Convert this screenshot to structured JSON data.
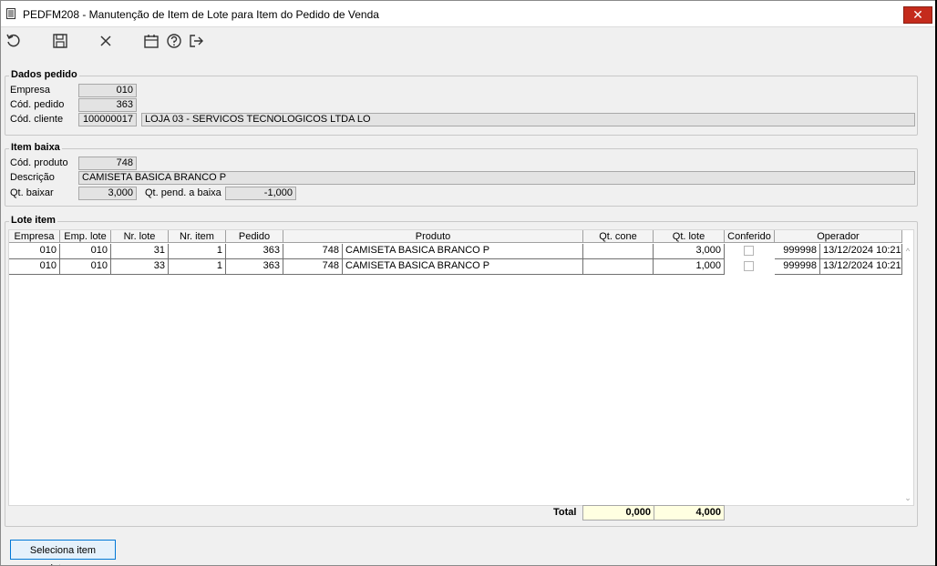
{
  "window": {
    "title": "PEDFM208 - Manutenção de Item de Lote para Item do Pedido de Venda",
    "close_symbol": "✕"
  },
  "toolbar": {
    "icons": [
      "undo-icon",
      "save-icon",
      "cancel-icon",
      "calendar-icon",
      "help-icon",
      "exit-icon"
    ]
  },
  "dados_pedido": {
    "title": "Dados pedido",
    "empresa_label": "Empresa",
    "empresa_value": "010",
    "pedido_label": "Cód. pedido",
    "pedido_value": "363",
    "cliente_label": "Cód. cliente",
    "cliente_code": "100000017",
    "cliente_name": "LOJA 03 - SERVICOS TECNOLOGICOS LTDA   LO"
  },
  "item_baixa": {
    "title": "Item baixa",
    "produto_label": "Cód. produto",
    "produto_value": "748",
    "descricao_label": "Descrição",
    "descricao_value": "CAMISETA BASICA BRANCO P",
    "qt_baixar_label": "Qt. baixar",
    "qt_baixar_value": "3,000",
    "qt_pend_label": "Qt. pend. a baixa",
    "qt_pend_value": "-1,000"
  },
  "lote_item": {
    "title": "Lote item",
    "columns": [
      "Empresa",
      "Emp. lote",
      "Nr. lote",
      "Nr. item",
      "Pedido",
      "Produto",
      "Qt. cone",
      "Qt. lote",
      "Conferido",
      "Operador"
    ],
    "rows": [
      {
        "empresa": "010",
        "emp_lote": "010",
        "nr_lote": "31",
        "nr_item": "1",
        "pedido": "363",
        "produto_code": "748",
        "produto_name": "CAMISETA BASICA BRANCO P",
        "qt_cone": "",
        "qt_lote": "3,000",
        "conferido": false,
        "operador_code": "999998",
        "operador_datetime": "13/12/2024 10:21:"
      },
      {
        "empresa": "010",
        "emp_lote": "010",
        "nr_lote": "33",
        "nr_item": "1",
        "pedido": "363",
        "produto_code": "748",
        "produto_name": "CAMISETA BASICA BRANCO P",
        "qt_cone": "",
        "qt_lote": "1,000",
        "conferido": false,
        "operador_code": "999998",
        "operador_datetime": "13/12/2024 10:21:"
      }
    ],
    "total_label": "Total",
    "total_qt_cone": "0,000",
    "total_qt_lote": "4,000"
  },
  "actions": {
    "seleciona_label": "Seleciona item lote..."
  }
}
